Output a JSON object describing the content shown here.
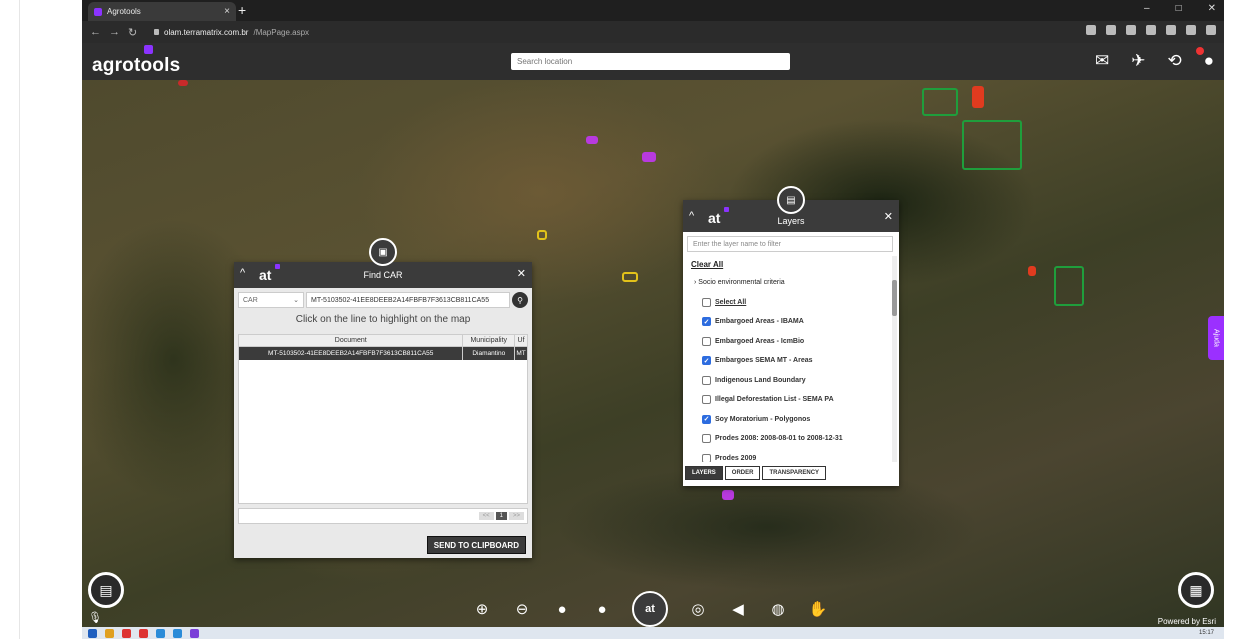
{
  "browser": {
    "tab_title": "Agrotools",
    "tab_close": "×",
    "new_tab": "+",
    "url_host": "olam.terramatrix.com.br",
    "url_path": "/MapPage.aspx",
    "win_min": "–",
    "win_max": "□",
    "win_close": "✕"
  },
  "app": {
    "logo": "agrotools",
    "search_placeholder": "Search location",
    "icons": [
      "mail-icon",
      "satellite-icon",
      "share-icon",
      "user-icon"
    ],
    "accent": "#8b33ff"
  },
  "find_car": {
    "title": "Find CAR",
    "logo": "at",
    "select_value": "CAR",
    "input_value": "MT-5103502-41EE8DEEB2A14FBFB7F3613CB811CA55",
    "hint": "Click on the line to highlight on the map",
    "columns": [
      "Document",
      "Municipality",
      "Uf"
    ],
    "rows": [
      [
        "MT-5103502-41EE8DEEB2A14FBFB7F3613CB811CA55",
        "Diamantino",
        "MT"
      ]
    ],
    "pager": [
      "<<",
      "1",
      ">>"
    ],
    "send_button": "SEND TO CLIPBOARD"
  },
  "layers": {
    "title": "Layers",
    "logo": "at",
    "filter_placeholder": "Enter the layer name to filter",
    "clear_all": "Clear All",
    "category": "Socio environmental criteria",
    "items": [
      {
        "label": "Select All",
        "checked": false
      },
      {
        "label": "Embargoed Areas - IBAMA",
        "checked": true
      },
      {
        "label": "Embargoed Areas - IcmBio",
        "checked": false
      },
      {
        "label": "Embargoes SEMA MT - Areas",
        "checked": true
      },
      {
        "label": "Indigenous Land Boundary",
        "checked": false
      },
      {
        "label": "Illegal Deforestation List - SEMA PA",
        "checked": false
      },
      {
        "label": "Soy Moratorium - Polygonos",
        "checked": true
      },
      {
        "label": "Prodes 2008: 2008-08-01 to 2008-12-31",
        "checked": false
      },
      {
        "label": "Prodes 2009",
        "checked": false
      }
    ],
    "tabs": [
      "LAYERS",
      "ORDER",
      "TRANSPARENCY"
    ]
  },
  "side_tab": "Ajuda",
  "map_credit": "Powered by Esri",
  "toolbar": [
    "zoom-in-icon",
    "zoom-out-icon",
    "plus-circle-icon",
    "minus-circle-icon",
    "at-logo",
    "compass-icon",
    "announce-icon",
    "globe-icon",
    "hand-icon"
  ],
  "taskbar_time": "15:17"
}
